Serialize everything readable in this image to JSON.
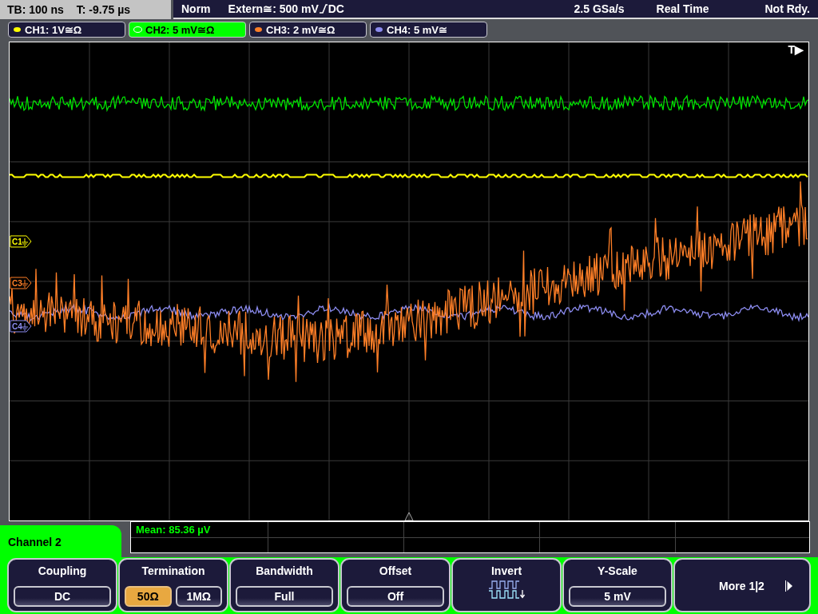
{
  "status_bar": {
    "timebase": "TB: 100 ns",
    "trigger_time": "T: -9.75 µs",
    "mode": "Norm",
    "trigger_source": "Extern≅: 500 mV",
    "trigger_coupling": "DC",
    "sample_rate": "2.5 GSa/s",
    "acquisition": "Real Time",
    "state": "Not Rdy."
  },
  "channel_tabs": [
    {
      "label": "CH1: 1V≅Ω",
      "color": "#ffff00",
      "selected": false
    },
    {
      "label": "CH2: 5 mV≅Ω",
      "color": "#00ff00",
      "selected": true
    },
    {
      "label": "CH3: 2 mV≅Ω",
      "color": "#ff7f27",
      "selected": false
    },
    {
      "label": "CH4: 5 mV≅",
      "color": "#8c8cf0",
      "selected": false
    }
  ],
  "display": {
    "trigger_label": "T▶",
    "markers": [
      {
        "label": "C1",
        "color": "#ffff00"
      },
      {
        "label": "C3",
        "color": "#ff7f27"
      },
      {
        "label": "C4",
        "color": "#8c8cf0"
      }
    ]
  },
  "panel_title": "Channel 2",
  "measurement": "Mean: 85.36 µV",
  "softkeys": [
    {
      "title": "Coupling",
      "kind": "value",
      "value": "DC"
    },
    {
      "title": "Termination",
      "kind": "choice",
      "options": [
        {
          "label": "50Ω",
          "selected": true
        },
        {
          "label": "1MΩ",
          "selected": false
        }
      ]
    },
    {
      "title": "Bandwidth",
      "kind": "value",
      "value": "Full"
    },
    {
      "title": "Offset",
      "kind": "value",
      "value": "Off"
    },
    {
      "title": "Invert",
      "kind": "icon"
    },
    {
      "title": "Y-Scale",
      "kind": "value",
      "value": "5 mV"
    },
    {
      "title": "More 1|2",
      "kind": "more"
    }
  ]
}
